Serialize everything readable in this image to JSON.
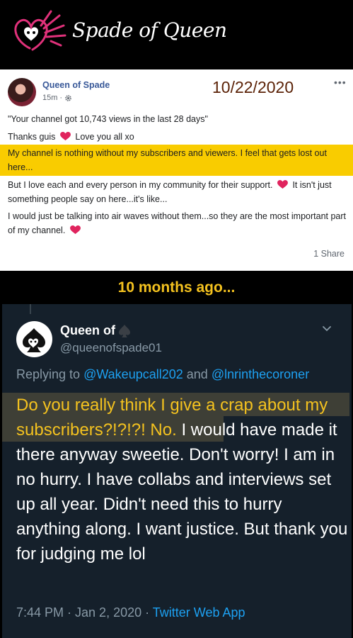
{
  "banner": {
    "brand": "Spade of Queen",
    "colors": {
      "logo": "#e0317a",
      "background": "#000000"
    }
  },
  "fb_post": {
    "author": "Queen of Spade",
    "time": "15m",
    "privacy_icon": "gear-icon",
    "date_overlay": "10/22/2020",
    "more_label": "•••",
    "p1": "\"Your channel got 10,743 views in the last 28 days\"",
    "p2_before": "Thanks guis",
    "p2_after": "Love you all xo",
    "p3": "My channel is nothing without my subscribers and viewers. I feel that gets lost out here...",
    "p4_before": "But I love each and every person in my community for their support.",
    "p4_after": "It isn't just something people say on here...it's like...",
    "p5": "I would just be talking into air waves without them...so they are the most important part of my channel.",
    "share": "1 Share",
    "colors": {
      "highlight": "#f9cc00",
      "name": "#385898",
      "heart": "#e0245e"
    }
  },
  "caption": "10 months ago...",
  "tweet": {
    "name": "Queen of",
    "handle": "@queenofspade01",
    "replying_prefix": "Replying to",
    "mention1": "@Wakeupcall202",
    "and": "and",
    "mention2": "@lnrinthecoroner",
    "highlighted": "Do you really think I give a crap about my subscribers?!?!?! No.",
    "rest": "I would have made it there anyway sweetie. Don't worry! I am in no hurry. I have collabs and interviews set up all year. Didn't need this to hurry anything along. I want justice. But thank you for judging me lol",
    "timestamp": "7:44 PM · Jan 2, 2020 ·",
    "app": "Twitter Web App",
    "colors": {
      "background": "#15202b",
      "mention": "#1da1f2",
      "highlight_text": "#f4c21f"
    }
  }
}
